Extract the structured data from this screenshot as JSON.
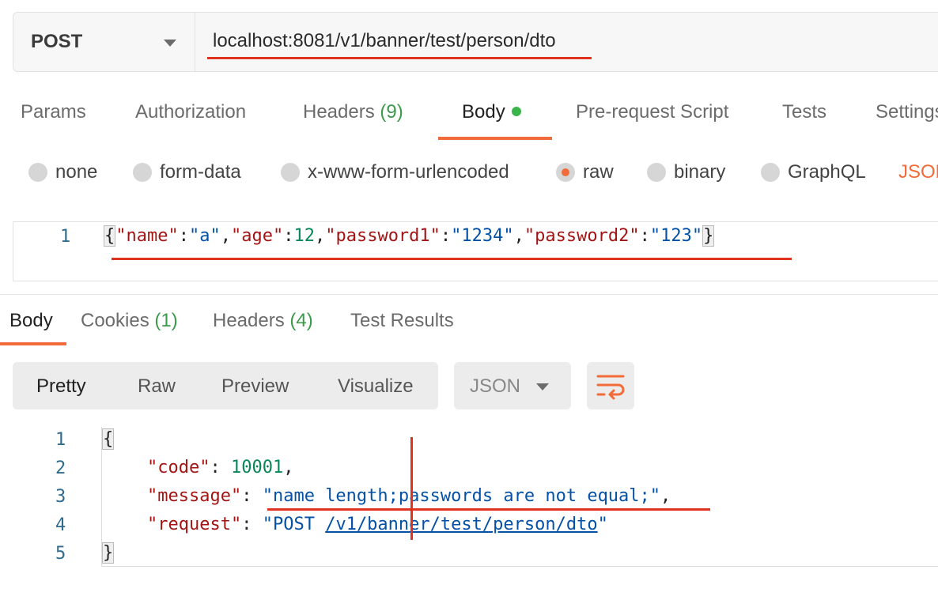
{
  "request": {
    "method": "POST",
    "url": "localhost:8081/v1/banner/test/person/dto"
  },
  "request_tabs": {
    "params": "Params",
    "authorization": "Authorization",
    "headers": "Headers",
    "headers_count": "(9)",
    "body": "Body",
    "pre_request": "Pre-request Script",
    "tests": "Tests",
    "settings": "Settings"
  },
  "body_types": {
    "none": "none",
    "form_data": "form-data",
    "urlencoded": "x-www-form-urlencoded",
    "raw": "raw",
    "binary": "binary",
    "graphql": "GraphQL",
    "json": "JSON",
    "selected": "raw"
  },
  "request_body": {
    "line_number": "1",
    "open": "{",
    "k1": "\"name\"",
    "v1": "\"a\"",
    "k2": "\"age\"",
    "v2": "12",
    "k3": "\"password1\"",
    "v3": "\"1234\"",
    "k4": "\"password2\"",
    "v4": "\"123\"",
    "close": "}"
  },
  "response_tabs": {
    "body": "Body",
    "cookies": "Cookies",
    "cookies_count": "(1)",
    "headers": "Headers",
    "headers_count": "(4)",
    "test_results": "Test Results"
  },
  "response_toolbar": {
    "pretty": "Pretty",
    "raw": "Raw",
    "preview": "Preview",
    "visualize": "Visualize",
    "format": "JSON",
    "wrap_icon": "wrap-lines-icon"
  },
  "response_body": {
    "line_numbers": [
      "1",
      "2",
      "3",
      "4",
      "5"
    ],
    "open": "{",
    "code_key": "\"code\"",
    "code_value": "10001",
    "message_key": "\"message\"",
    "message_value": "\"name length;passwords are not equal;\"",
    "request_key": "\"request\"",
    "request_prefix": "\"POST ",
    "request_path": "/v1/banner/test/person/dto",
    "request_suffix": "\"",
    "close": "}"
  },
  "colors": {
    "accent": "#f26b3a",
    "annotation_red": "#e0331f",
    "json_key": "#a31515",
    "json_string": "#0451a5",
    "json_number": "#098658",
    "count_green": "#3c9a4a"
  }
}
